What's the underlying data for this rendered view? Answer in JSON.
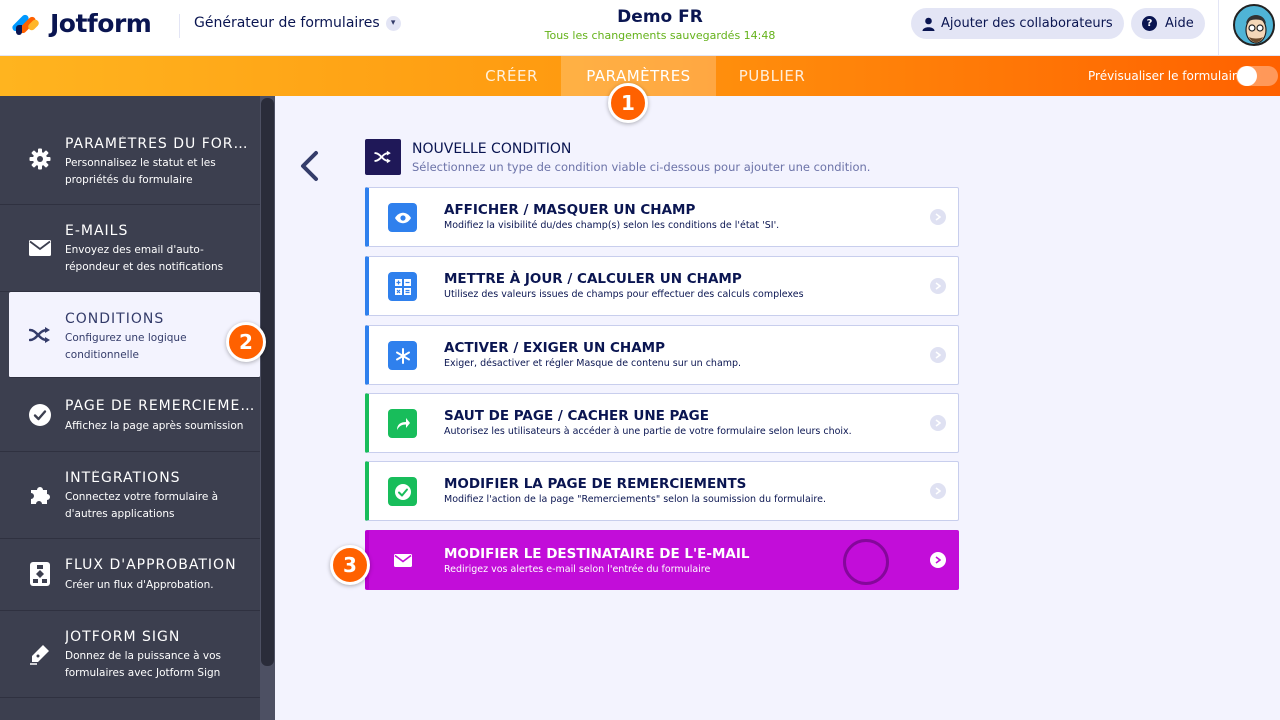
{
  "header": {
    "brand": "Jotform",
    "builder_label": "Générateur de formulaires",
    "form_title": "Demo FR",
    "save_status": "Tous les changements sauvegardés 14:48",
    "collaborators_label": "Ajouter des collaborateurs",
    "help_label": "Aide",
    "help_glyph": "?"
  },
  "nav": {
    "tabs": [
      {
        "label": "CRÉER",
        "active": false
      },
      {
        "label": "PARAMÈTRES",
        "active": true
      },
      {
        "label": "PUBLIER",
        "active": false
      }
    ],
    "preview_label": "Prévisualiser le formulaire",
    "preview_toggle_on": false
  },
  "sidebar": {
    "items": [
      {
        "icon": "gear-icon",
        "title": "PARAMÈTRES DU FORMULAIRE",
        "desc": "Personnalisez le statut et les propriétés du formulaire"
      },
      {
        "icon": "envelope-icon",
        "title": "E-MAILS",
        "desc": "Envoyez des email d'auto-répondeur et des notifications"
      },
      {
        "icon": "shuffle-icon",
        "title": "CONDITIONS",
        "desc": "Configurez une logique conditionnelle"
      },
      {
        "icon": "check-circle-icon",
        "title": "PAGE DE REMERCIEMENTS",
        "desc": "Affichez la page après soumission"
      },
      {
        "icon": "puzzle-icon",
        "title": "INTÉGRATIONS",
        "desc": "Connectez votre formulaire à d'autres applications"
      },
      {
        "icon": "approval-flow-icon",
        "title": "FLUX D'APPROBATION",
        "desc": "Créer un flux d'Approbation."
      },
      {
        "icon": "pen-icon",
        "title": "JOTFORM SIGN",
        "desc": "Donnez de la puissance à vos formulaires avec Jotform Sign"
      }
    ]
  },
  "main": {
    "title": "NOUVELLE CONDITION",
    "subtitle": "Sélectionnez un type de condition viable ci-dessous pour ajouter une condition.",
    "conditions": [
      {
        "icon": "eye-icon",
        "title": "AFFICHER / MASQUER UN CHAMP",
        "desc": "Modifiez la visibilité du/des champ(s) selon les conditions de l'état 'SI'."
      },
      {
        "icon": "calculator-icon",
        "title": "METTRE À JOUR / CALCULER UN CHAMP",
        "desc": "Utilisez des valeurs issues de champs pour effectuer des calculs complexes"
      },
      {
        "icon": "asterisk-icon",
        "title": "ACTIVER / EXIGER UN CHAMP",
        "desc": "Exiger, désactiver et régler Masque de contenu sur un champ."
      },
      {
        "icon": "share-arrow-icon",
        "title": "SAUT DE PAGE / CACHER UNE PAGE",
        "desc": "Autorisez les utilisateurs à accéder à une partie de votre formulaire selon leurs choix."
      },
      {
        "icon": "check-icon",
        "title": "MODIFIER LA PAGE DE REMERCIEMENTS",
        "desc": "Modifiez l'action de la page \"Remerciements\" selon la soumission du formulaire."
      },
      {
        "icon": "envelope-icon",
        "title": "MODIFIER LE DESTINATAIRE DE L'E-MAIL",
        "desc": "Redirigez vos alertes e-mail selon l'entrée du formulaire"
      }
    ]
  },
  "steps": [
    "1",
    "2",
    "3"
  ],
  "colors": {
    "orange": "#ff6100",
    "navy": "#0a1551",
    "sidebar": "#3c3f4f",
    "blue_accent": "#2f80ed",
    "green_accent": "#18bd5b",
    "selected_card": "#c20dd9"
  }
}
